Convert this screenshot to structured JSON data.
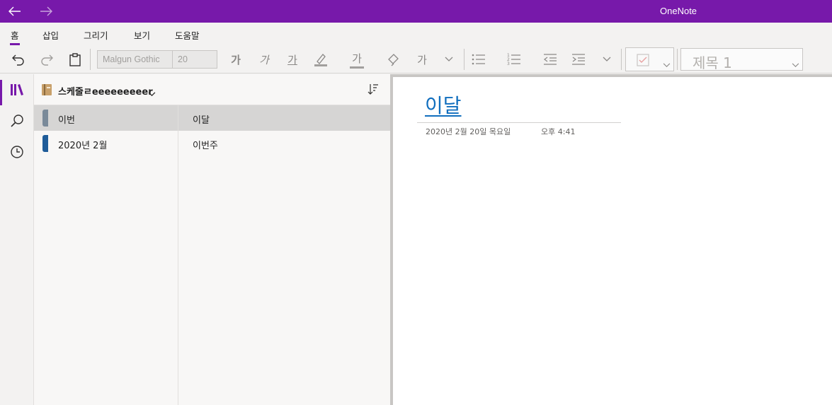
{
  "app": {
    "title": "OneNote"
  },
  "menu": {
    "tabs": [
      "홈",
      "삽입",
      "그리기",
      "보기",
      "도움말"
    ]
  },
  "toolbar": {
    "font_name": "Malgun Gothic",
    "font_size": "20",
    "bold_glyph": "가",
    "italic_glyph": "가",
    "underline_glyph": "가",
    "font_color_glyph": "가",
    "clear_format_glyph": "가",
    "style": "제목 1"
  },
  "notebook": {
    "name": "스케줄ㄹeeeeeeeeer",
    "sections": [
      {
        "label": "이번",
        "color": "#7a8a99",
        "selected": true
      },
      {
        "label": "2020년 2월",
        "color": "#1f5c99",
        "selected": false
      }
    ],
    "pages": [
      {
        "label": "이달",
        "selected": true
      },
      {
        "label": "이번주",
        "selected": false
      }
    ]
  },
  "page": {
    "title": "이달",
    "date": "2020년 2월 20일 목요일",
    "time": "오후 4:41"
  },
  "colors": {
    "accent": "#7719aa",
    "link": "#106ebe"
  }
}
